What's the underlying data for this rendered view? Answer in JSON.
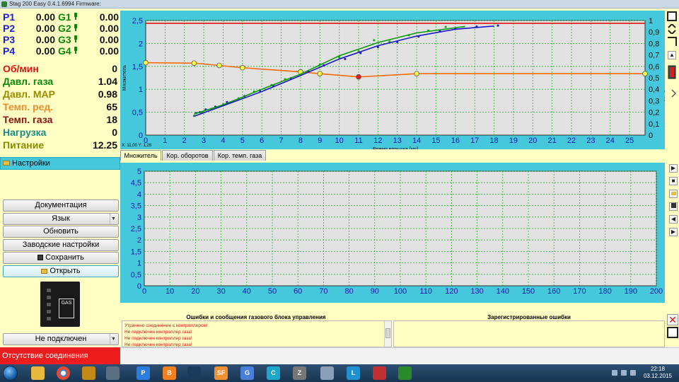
{
  "window": {
    "title": "Stag 200 Easy 0.4.1.6994 Firmware:"
  },
  "pressures": [
    {
      "p": "P1",
      "pval": "0.00",
      "g": "G1",
      "gval": "0.00"
    },
    {
      "p": "P2",
      "pval": "0.00",
      "g": "G2",
      "gval": "0.00"
    },
    {
      "p": "P3",
      "pval": "0.00",
      "g": "G3",
      "gval": "0.00"
    },
    {
      "p": "P4",
      "pval": "0.00",
      "g": "G4",
      "gval": "0.00"
    }
  ],
  "sensors": [
    {
      "label": "Об/мин",
      "value": "0",
      "color": "#e01010"
    },
    {
      "label": "Давл. газа",
      "value": "1.04",
      "color": "#0a8a0a"
    },
    {
      "label": "Давл. MAP",
      "value": "0.98",
      "color": "#9a8a00"
    },
    {
      "label": "Темп. ред.",
      "value": "65",
      "color": "#f08a30"
    },
    {
      "label": "Темп. газа",
      "value": "18",
      "color": "#8a1010"
    },
    {
      "label": "Нагрузка",
      "value": "0",
      "color": "#1a8a8a"
    },
    {
      "label": "Питание",
      "value": "12.25",
      "color": "#8a8a00"
    }
  ],
  "settings_label": "Настройки",
  "buttons": {
    "documentation": "Документация",
    "language": "Язык",
    "update": "Обновить",
    "factory": "Заводские настройки",
    "save": "Сохранить",
    "open": "Открыть",
    "connection": "Не подключен"
  },
  "device_label": "GAS",
  "coord_readout": "X: 11,00  Y: 1,26",
  "tabs": [
    "Множитель",
    "Кор. оборотов",
    "Кор. темп. газа"
  ],
  "errors_header": "Ошибки и сообщения газового блока управления",
  "registered_header": "Зарегистрированные ошибки",
  "errors": [
    "Утрачено соединение с контроллером!",
    "Не подключен контроллер газа!",
    "Не подключен контроллер газа!",
    "Не подключен контроллер газа!"
  ],
  "status": "Отсутствие соединения",
  "taskbar": {
    "time": "22:18",
    "date": "03.12.2015"
  },
  "chart_data": [
    {
      "type": "line",
      "xlabel": "Время впрыска [мс]",
      "ylabel": "Множитель",
      "ylabel_right": "Давление MAP [бар]",
      "xlim": [
        0,
        25.8
      ],
      "ylim": [
        0,
        2.5
      ],
      "ylim_right": [
        0,
        1
      ],
      "x_ticks": [
        0,
        1,
        2,
        3,
        4,
        5,
        6,
        7,
        8,
        9,
        10,
        11,
        12,
        13,
        14,
        15,
        16,
        17,
        18,
        19,
        20,
        21,
        22,
        23,
        24,
        25
      ],
      "y_ticks": [
        "0",
        "0,5",
        "1",
        "1,5",
        "2",
        "2,5"
      ],
      "y_ticks_right": [
        "0",
        "0,1",
        "0,2",
        "0,3",
        "0,4",
        "0,5",
        "0,6",
        "0,7",
        "0,8",
        "0,9",
        "1"
      ],
      "grid": true,
      "series": [
        {
          "color": "#ff6a00",
          "x": [
            0,
            2.5,
            3.8,
            5,
            8,
            9,
            11,
            14,
            25.8
          ],
          "y": [
            1.58,
            1.57,
            1.52,
            1.47,
            1.38,
            1.34,
            1.27,
            1.34,
            1.34
          ],
          "markers": [
            0,
            1,
            2,
            3,
            4,
            5,
            6,
            7,
            8
          ],
          "marker_color": "#ffff44",
          "highlight": 6,
          "highlight_color": "#e02020"
        },
        {
          "color": "#e01010",
          "x": [
            0,
            25.8
          ],
          "y": [
            2.44,
            2.44
          ]
        },
        {
          "color": "#0a9a0a",
          "x": [
            2.5,
            4,
            6,
            8,
            10,
            12,
            14,
            16.5
          ],
          "y": [
            0.46,
            0.66,
            1.0,
            1.33,
            1.73,
            2.02,
            2.23,
            2.37
          ]
        },
        {
          "color": "#1818cc",
          "x": [
            2.5,
            4,
            6,
            8,
            10,
            12,
            14,
            16,
            18
          ],
          "y": [
            0.41,
            0.64,
            0.95,
            1.3,
            1.66,
            1.95,
            2.16,
            2.31,
            2.38
          ]
        }
      ],
      "scatter": [
        {
          "color": "#2222cc",
          "x": [
            2.6,
            2.8,
            3.1,
            3.6,
            4.2,
            5.1,
            5.9,
            6.6,
            7.5,
            8.4,
            9.2,
            10.3,
            11.1,
            12.0,
            13.0,
            14.1,
            15.2,
            16.0,
            17.1,
            18.2
          ],
          "y": [
            0.48,
            0.5,
            0.56,
            0.62,
            0.72,
            0.85,
            0.97,
            1.08,
            1.24,
            1.39,
            1.52,
            1.66,
            1.79,
            1.92,
            2.03,
            2.15,
            2.27,
            2.32,
            2.37,
            2.39
          ]
        },
        {
          "color": "#22aa22",
          "x": [
            2.5,
            2.9,
            3.4,
            4.0,
            4.8,
            5.6,
            6.5,
            7.2,
            8.1,
            9.0,
            10.0,
            11.0,
            11.8,
            12.6,
            13.6,
            14.6,
            15.5
          ],
          "y": [
            0.42,
            0.5,
            0.57,
            0.67,
            0.8,
            0.95,
            1.09,
            1.22,
            1.37,
            1.54,
            1.7,
            1.83,
            2.07,
            2.04,
            2.18,
            2.28,
            2.36
          ]
        }
      ]
    },
    {
      "type": "line",
      "xlim": [
        0,
        200
      ],
      "ylim": [
        0,
        5
      ],
      "x_ticks": [
        0,
        10,
        20,
        30,
        40,
        50,
        60,
        70,
        80,
        90,
        100,
        110,
        120,
        130,
        140,
        150,
        160,
        170,
        180,
        190,
        200
      ],
      "y_ticks": [
        "0",
        "0,5",
        "1",
        "1,5",
        "2",
        "2,5",
        "3",
        "3,5",
        "4",
        "4,5",
        "5"
      ],
      "grid": true,
      "series": []
    }
  ]
}
